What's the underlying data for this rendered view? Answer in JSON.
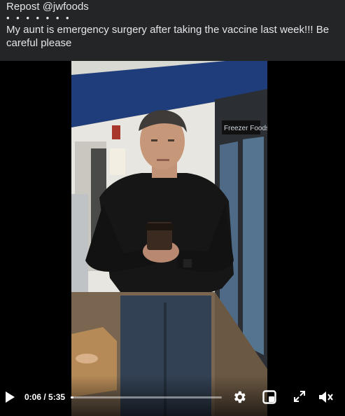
{
  "post": {
    "line1": "Repost @jwfoods",
    "line2": "• • • • • • •",
    "line3": "My aunt is emergency surgery after taking the vaccine last week!!! Be",
    "line4": "careful please"
  },
  "video": {
    "current_time": "0:06",
    "duration": "5:35",
    "time_display": "0:06 / 5:35",
    "progress_fraction": 0.018,
    "store_sign": "Freezer Foods"
  },
  "colors": {
    "page_bg": "#242526",
    "text": "#e4e6eb",
    "wall_blue": "#1f3d7a"
  },
  "icons": [
    "play-icon",
    "settings-gear-icon",
    "picture-in-picture-icon",
    "fullscreen-icon",
    "volume-icon"
  ]
}
